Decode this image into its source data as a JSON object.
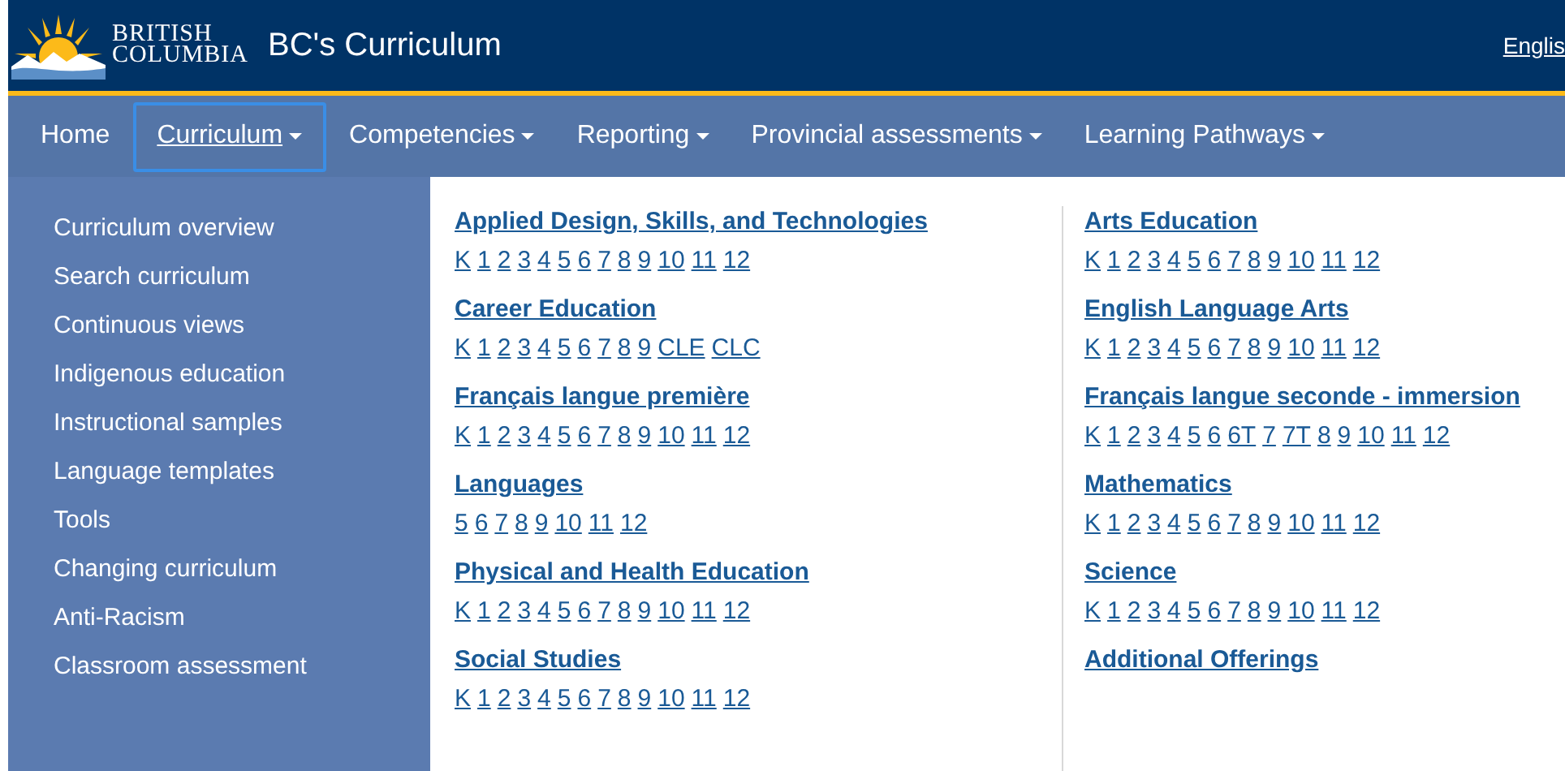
{
  "header": {
    "logo_lines": [
      "BRITISH",
      "COLUMBIA"
    ],
    "site_title": "BC's Curriculum",
    "language_link": "Englis"
  },
  "nav": [
    {
      "label": "Home",
      "dropdown": false,
      "selected": false
    },
    {
      "label": "Curriculum",
      "dropdown": true,
      "selected": true
    },
    {
      "label": "Competencies",
      "dropdown": true,
      "selected": false
    },
    {
      "label": "Reporting",
      "dropdown": true,
      "selected": false
    },
    {
      "label": "Provincial assessments",
      "dropdown": true,
      "selected": false
    },
    {
      "label": "Learning Pathways",
      "dropdown": true,
      "selected": false
    }
  ],
  "menu": [
    "Curriculum overview",
    "Search curriculum",
    "Continuous views",
    "Indigenous education",
    "Instructional samples",
    "Language templates",
    "Tools",
    "Changing curriculum",
    "Anti-Racism",
    "Classroom assessment"
  ],
  "subject_columns": [
    [
      {
        "title": "Applied Design, Skills, and Technologies",
        "grades": [
          "K",
          "1",
          "2",
          "3",
          "4",
          "5",
          "6",
          "7",
          "8",
          "9",
          "10",
          "11",
          "12"
        ]
      },
      {
        "title": "Career Education",
        "grades": [
          "K",
          "1",
          "2",
          "3",
          "4",
          "5",
          "6",
          "7",
          "8",
          "9",
          "CLE",
          "CLC"
        ]
      },
      {
        "title": "Français langue première",
        "grades": [
          "K",
          "1",
          "2",
          "3",
          "4",
          "5",
          "6",
          "7",
          "8",
          "9",
          "10",
          "11",
          "12"
        ]
      },
      {
        "title": "Languages",
        "grades": [
          "5",
          "6",
          "7",
          "8",
          "9",
          "10",
          "11",
          "12"
        ]
      },
      {
        "title": "Physical and Health Education",
        "grades": [
          "K",
          "1",
          "2",
          "3",
          "4",
          "5",
          "6",
          "7",
          "8",
          "9",
          "10",
          "11",
          "12"
        ]
      },
      {
        "title": "Social Studies",
        "grades": [
          "K",
          "1",
          "2",
          "3",
          "4",
          "5",
          "6",
          "7",
          "8",
          "9",
          "10",
          "11",
          "12"
        ]
      }
    ],
    [
      {
        "title": "Arts Education",
        "grades": [
          "K",
          "1",
          "2",
          "3",
          "4",
          "5",
          "6",
          "7",
          "8",
          "9",
          "10",
          "11",
          "12"
        ]
      },
      {
        "title": "English Language Arts",
        "grades": [
          "K",
          "1",
          "2",
          "3",
          "4",
          "5",
          "6",
          "7",
          "8",
          "9",
          "10",
          "11",
          "12"
        ]
      },
      {
        "title": "Français langue seconde - immersion",
        "grades": [
          "K",
          "1",
          "2",
          "3",
          "4",
          "5",
          "6",
          "6T",
          "7",
          "7T",
          "8",
          "9",
          "10",
          "11",
          "12"
        ]
      },
      {
        "title": "Mathematics",
        "grades": [
          "K",
          "1",
          "2",
          "3",
          "4",
          "5",
          "6",
          "7",
          "8",
          "9",
          "10",
          "11",
          "12"
        ]
      },
      {
        "title": "Science",
        "grades": [
          "K",
          "1",
          "2",
          "3",
          "4",
          "5",
          "6",
          "7",
          "8",
          "9",
          "10",
          "11",
          "12"
        ]
      },
      {
        "title": "Additional Offerings"
      }
    ]
  ]
}
